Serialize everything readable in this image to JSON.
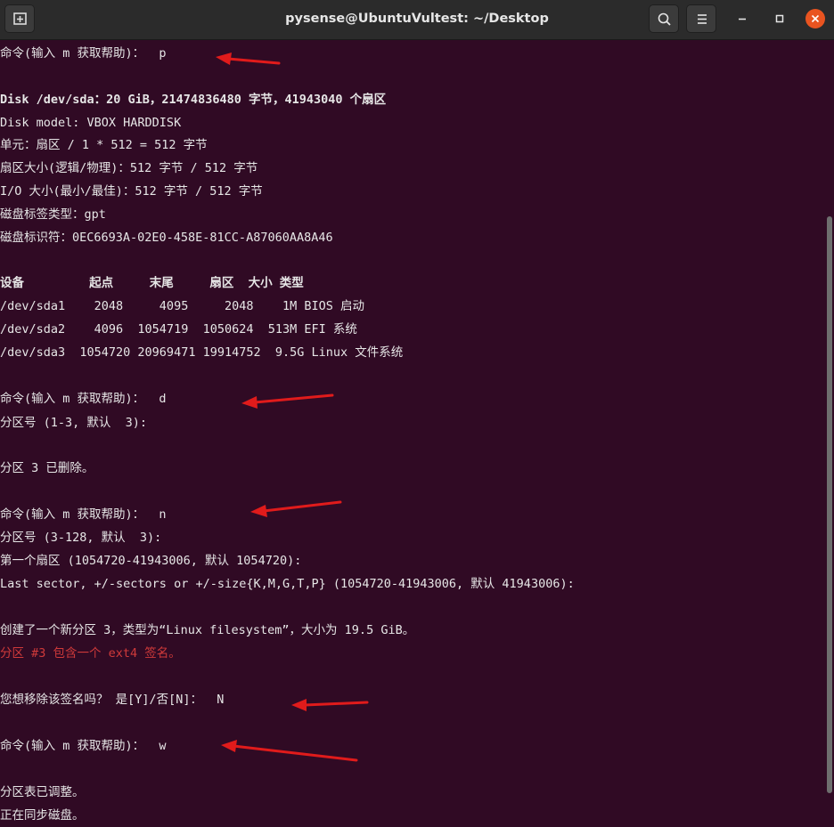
{
  "window": {
    "title": "pysense@UbuntuVultest: ~/Desktop"
  },
  "colors": {
    "background": "#300a24",
    "text": "#e6e6e6",
    "warning": "#d03a3a",
    "arrow": "#e01b1b",
    "close": "#e95420"
  },
  "icons": {
    "new_tab": "new-tab-icon",
    "search": "search-icon",
    "menu": "hamburger-menu-icon",
    "minimize": "minimize-icon",
    "maximize": "maximize-icon",
    "close": "close-icon"
  },
  "terminal": {
    "lines": [
      "命令(输入 m 获取帮助)：  p",
      "",
      "Disk /dev/sda：20 GiB，21474836480 字节，41943040 个扇区",
      "Disk model: VBOX HARDDISK",
      "单元：扇区 / 1 * 512 = 512 字节",
      "扇区大小(逻辑/物理)：512 字节 / 512 字节",
      "I/O 大小(最小/最佳)：512 字节 / 512 字节",
      "磁盘标签类型：gpt",
      "磁盘标识符：0EC6693A-02E0-458E-81CC-A87060AA8A46",
      "",
      "设备         起点     末尾     扇区  大小 类型",
      "/dev/sda1    2048     4095     2048    1M BIOS 启动",
      "/dev/sda2    4096  1054719  1050624  513M EFI 系统",
      "/dev/sda3  1054720 20969471 19914752  9.5G Linux 文件系统",
      "",
      "命令(输入 m 获取帮助)：  d",
      "分区号 (1-3, 默认  3):",
      "",
      "分区 3 已删除。",
      "",
      "命令(输入 m 获取帮助)：  n",
      "分区号 (3-128, 默认  3):",
      "第一个扇区 (1054720-41943006, 默认 1054720):",
      "Last sector, +/-sectors or +/-size{K,M,G,T,P} (1054720-41943006, 默认 41943006):",
      "",
      "创建了一个新分区 3，类型为“Linux filesystem”，大小为 19.5 GiB。",
      "分区 #3 包含一个 ext4 签名。",
      "",
      "您想移除该签名吗？ 是[Y]/否[N]：  N",
      "",
      "命令(输入 m 获取帮助)：  w",
      "",
      "分区表已调整。",
      "正在同步磁盘。"
    ]
  }
}
